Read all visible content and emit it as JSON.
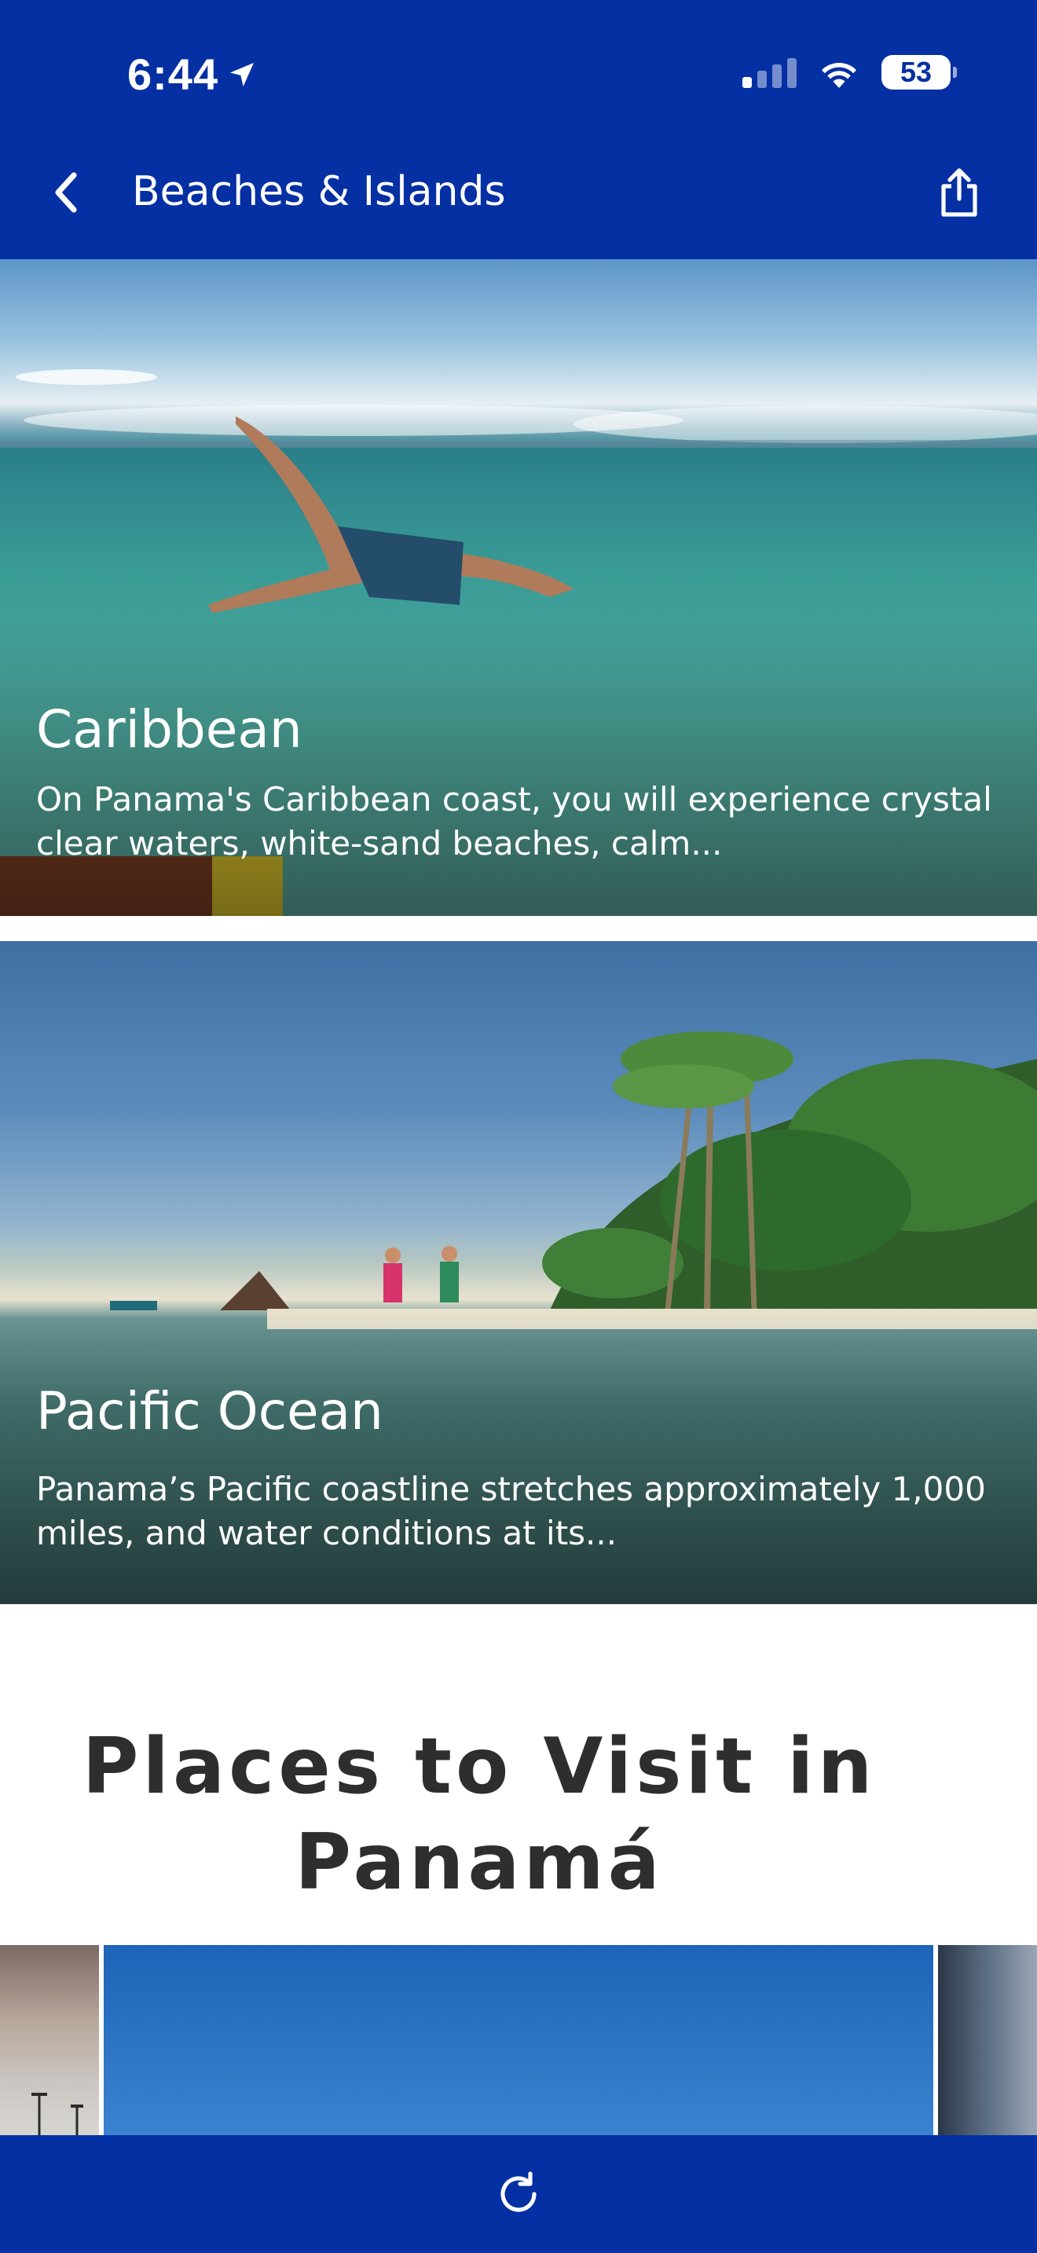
{
  "status_bar": {
    "time": "6:44",
    "battery": "53",
    "location_icon": "location-arrow-icon",
    "signal_icon": "cellular-signal-icon",
    "wifi_icon": "wifi-icon"
  },
  "nav": {
    "title": "Beaches & Islands",
    "back_icon": "chevron-left-icon",
    "share_icon": "share-icon"
  },
  "cards": [
    {
      "title": "Caribbean",
      "description": "On Panama's Caribbean coast, you will experience crystal clear waters, white-sand beaches, calm..."
    },
    {
      "title": "Pacific Ocean",
      "description": "Panama’s Pacific coastline stretches approximately 1,000 miles, and water conditions at its..."
    }
  ],
  "section": {
    "title": "Places to Visit in Panamá"
  },
  "bottom_bar": {
    "refresh_icon": "refresh-icon"
  },
  "colors": {
    "primary": "#0530a3",
    "text_dark": "#2e2e2e",
    "white": "#ffffff"
  }
}
